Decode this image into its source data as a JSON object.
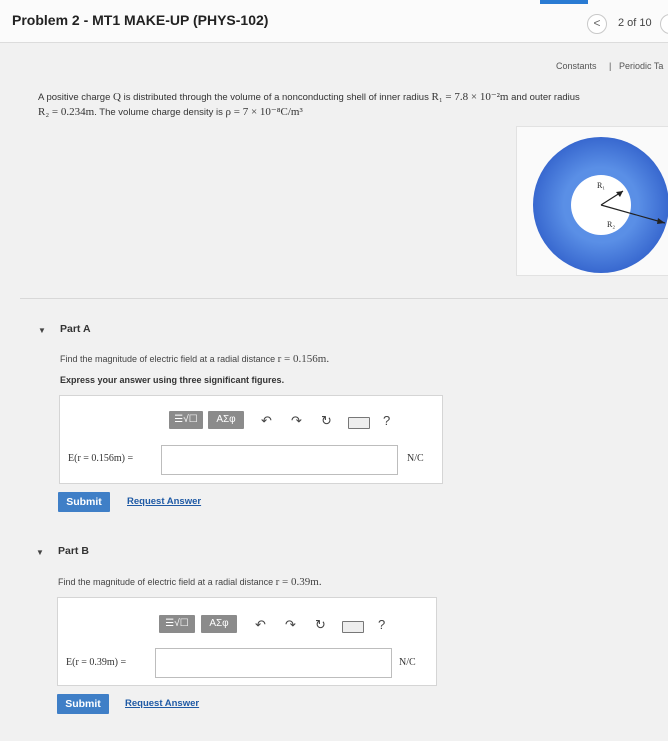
{
  "header": {
    "title": "Problem 2 - MT1 MAKE-UP (PHYS-102)",
    "pager": "2 of 10",
    "prev_label": "<"
  },
  "links": {
    "constants": "Constants",
    "separator": "|",
    "periodic_table": "Periodic Ta"
  },
  "problem": {
    "line1_prefix": "A positive charge",
    "symbol_Q": "Q",
    "line1_mid": "is distributed through the volume of a nonconducting shell of inner radius",
    "R1_expr": "R₁ = 7.8 × 10⁻²m",
    "line1_suffix": "and outer radius",
    "R2_expr": "R₂ = 0.234m",
    "line2_mid": ". The volume charge density is",
    "rho_expr": "ρ = 7 × 10⁻⁸C/m³"
  },
  "figure": {
    "label_R1": "R₁",
    "label_R2": "R₂",
    "outer_color": "#3f78dc",
    "inner_color": "#ffffff"
  },
  "toolbar": {
    "template_label": "☰√☐",
    "greek_label": "AΣφ",
    "undo_icon": "↶",
    "redo_icon": "↷",
    "reset_icon": "↻",
    "help_label": "?"
  },
  "partA": {
    "title": "Part A",
    "question_prefix": "Find the magnitude of electric field at a radial distance",
    "question_expr": "r = 0.156m.",
    "note": "Express your answer using three significant figures.",
    "answer_label": "E(r = 0.156m) =",
    "answer_value": "",
    "unit": "N/C",
    "submit": "Submit",
    "request": "Request Answer"
  },
  "partB": {
    "title": "Part B",
    "question_prefix": "Find the magnitude of electric field at a radial distance",
    "question_expr": "r = 0.39m.",
    "answer_label": "E(r = 0.39m) =",
    "answer_value": "",
    "unit": "N/C",
    "submit": "Submit",
    "request": "Request Answer"
  },
  "colors": {
    "accent": "#3f7fc7",
    "link": "#1f5aa5",
    "toolbar_button": "#8b8b8b"
  }
}
